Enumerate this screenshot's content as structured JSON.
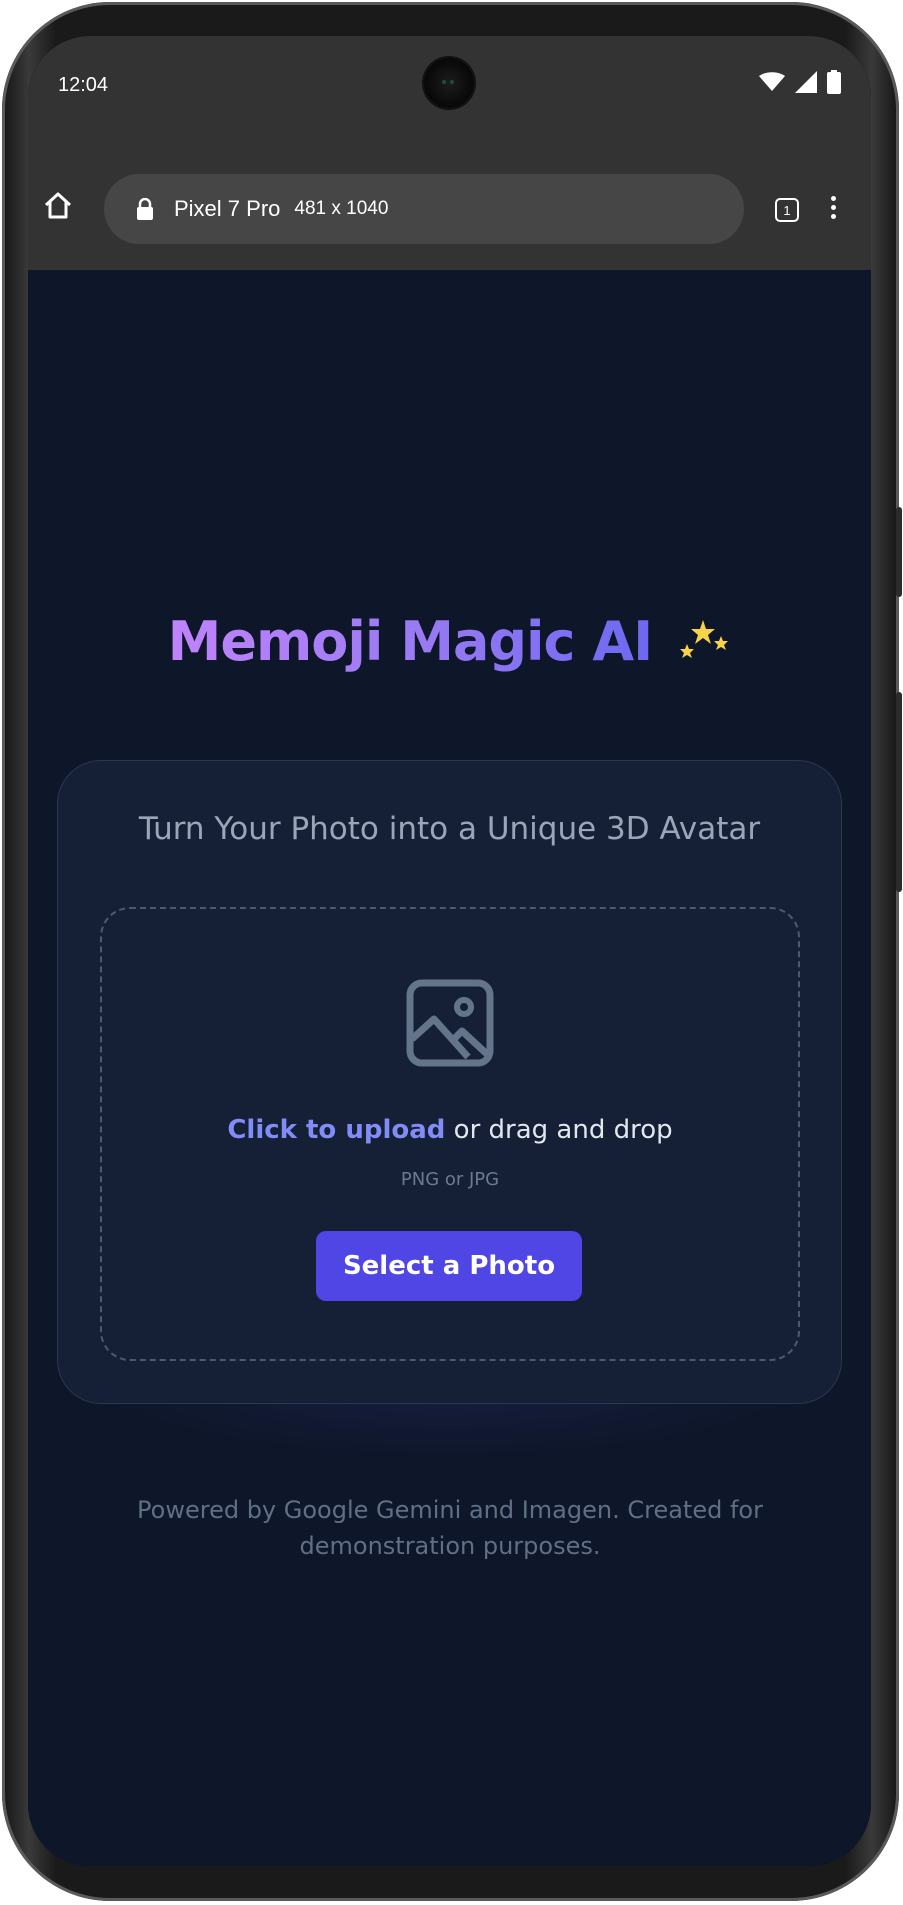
{
  "status_bar": {
    "time": "12:04"
  },
  "browser": {
    "device_name": "Pixel 7 Pro",
    "viewport": "481 x 1040",
    "tab_count": "1"
  },
  "app": {
    "title": "Memoji Magic AI",
    "subtitle": "Turn Your Photo into a Unique 3D Avatar",
    "upload": {
      "link_text": "Click to upload",
      "rest_text": " or drag and drop",
      "formats": "PNG or JPG",
      "button_label": "Select a Photo"
    },
    "footer": "Powered by Google Gemini and Imagen. Created for demonstration purposes."
  },
  "colors": {
    "background": "#0e1629",
    "card": "#152036",
    "accent": "#4f46e5",
    "link": "#818cf8",
    "title_gradient_start": "#c084fc",
    "title_gradient_end": "#6d69f0"
  },
  "icons": [
    "home-icon",
    "lock-icon",
    "tabs-icon",
    "more-vert-icon",
    "wifi-icon",
    "signal-icon",
    "battery-icon",
    "image-icon",
    "sparkles-icon"
  ]
}
